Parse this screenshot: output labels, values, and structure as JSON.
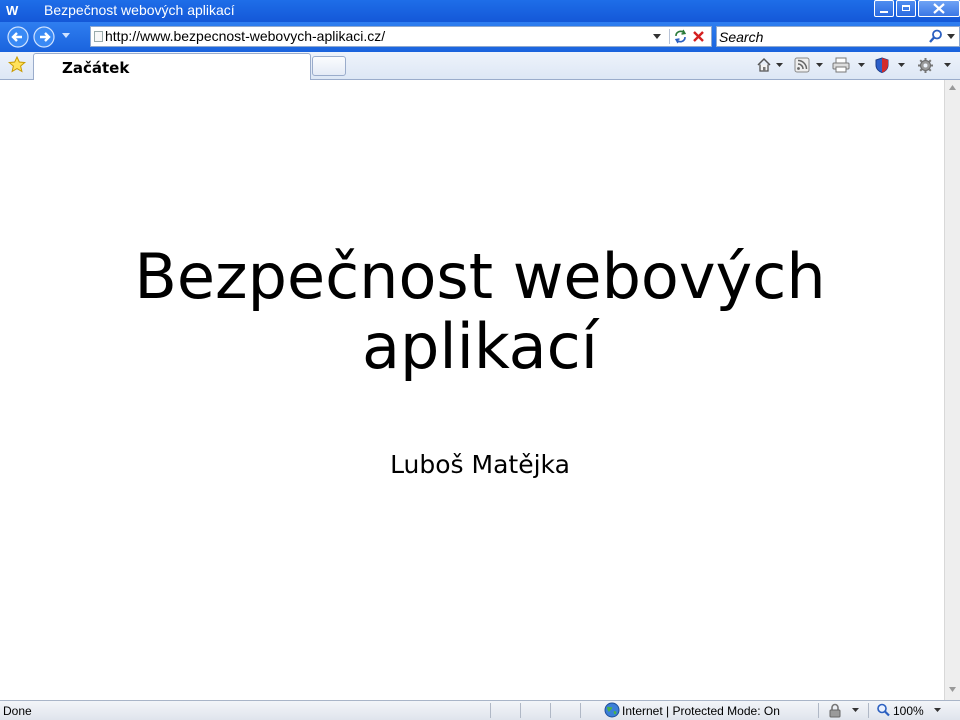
{
  "window": {
    "app_logo": "W",
    "title": "Bezpečnost webových aplikací"
  },
  "navigation": {
    "url": "http://www.bezpecnost-webovych-aplikaci.cz/",
    "search_placeholder": "Search"
  },
  "tabs": [
    {
      "label": "Začátek",
      "active": true
    }
  ],
  "content": {
    "heading_line1": "Bezpečnost webových",
    "heading_line2": "aplikací",
    "author": "Luboš Matějka"
  },
  "status": {
    "text": "Done",
    "zone": "Internet | Protected Mode: On",
    "zoom": "100%"
  },
  "icons": {
    "back": "back-arrow-icon",
    "forward": "forward-arrow-icon",
    "refresh": "refresh-icon",
    "stop": "stop-icon",
    "search": "magnifier-icon",
    "favorites": "star-icon",
    "home": "home-icon",
    "feeds": "rss-icon",
    "print": "printer-icon",
    "safety": "shield-icon",
    "tools": "gear-icon",
    "zone": "globe-icon",
    "security": "lock-icon",
    "zoom": "zoom-icon"
  },
  "colors": {
    "titlebar": "#1e6ee8",
    "accent": "#1a63dd",
    "tab_border": "#9aaccb"
  }
}
